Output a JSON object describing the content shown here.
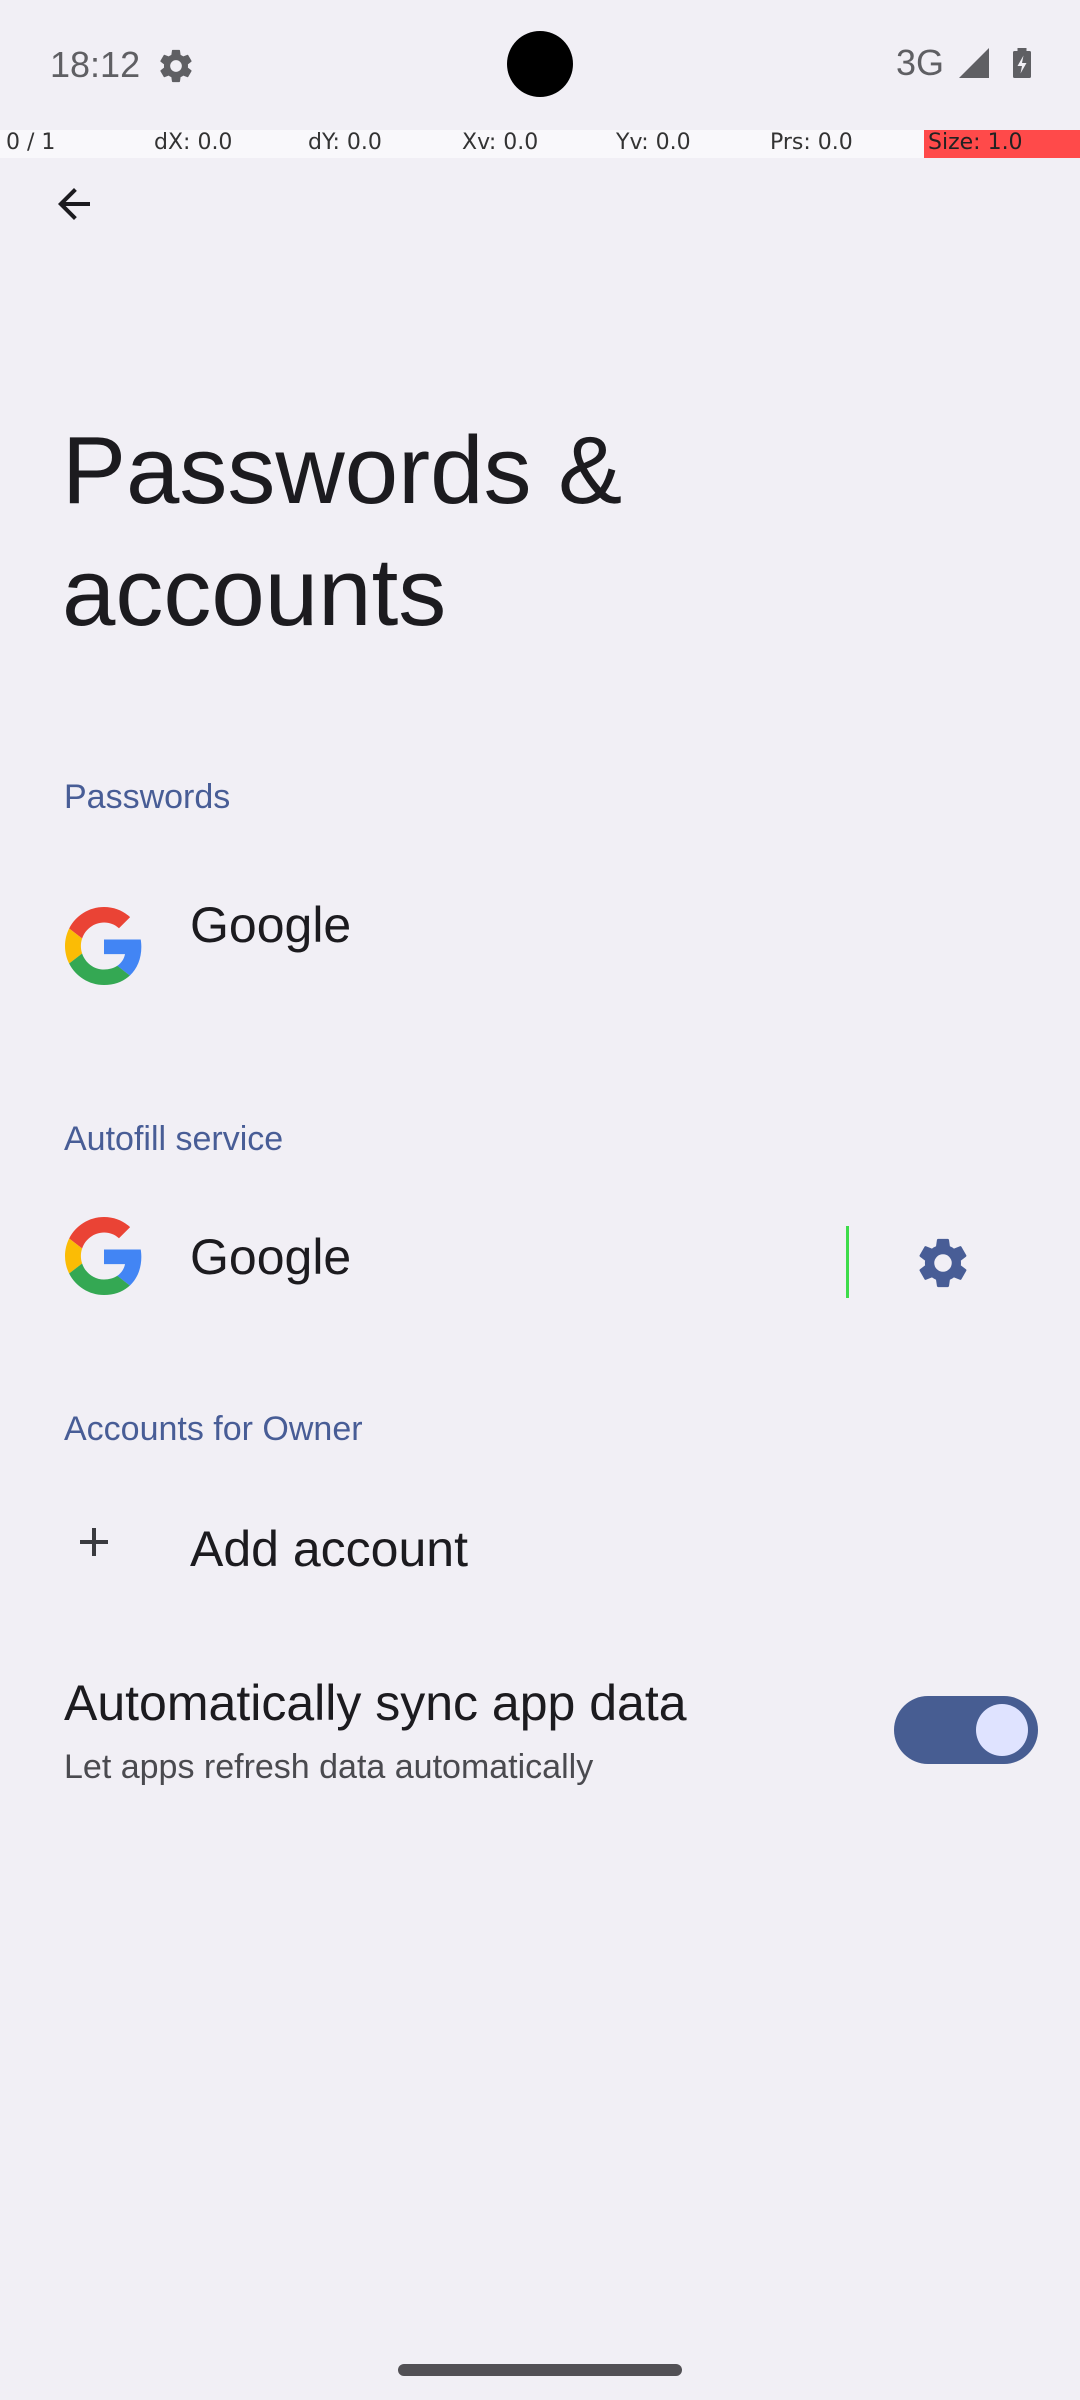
{
  "status_bar": {
    "time": "18:12",
    "network": "3G",
    "icons": [
      "gear-icon",
      "signal-icon",
      "battery-icon"
    ]
  },
  "pointer_overlay": {
    "pointer": "0 / 1",
    "dx": "dX: 0.0",
    "dy": "dY: 0.0",
    "xv": "Xv: 0.0",
    "yv": "Yv: 0.0",
    "prs": "Prs: 0.0",
    "size": "Size: 1.0"
  },
  "toolbar": {
    "back_icon": "arrow-back-icon"
  },
  "page": {
    "title": "Passwords & accounts"
  },
  "sections": {
    "passwords": {
      "header": "Passwords",
      "items": [
        {
          "title": "Google",
          "icon": "google-icon"
        }
      ]
    },
    "autofill": {
      "header": "Autofill service",
      "items": [
        {
          "title": "Google",
          "icon": "google-icon",
          "settings_icon": "gear-icon"
        }
      ]
    },
    "accounts": {
      "header": "Accounts for Owner",
      "items": [
        {
          "title": "Add account",
          "icon": "plus-icon"
        }
      ]
    },
    "sync": {
      "title": "Automatically sync app data",
      "summary": "Let apps refresh data automatically",
      "checked": true
    }
  },
  "colors": {
    "background": "#f1eff5",
    "accent": "#485d96",
    "toggle_track": "#475d92",
    "toggle_thumb": "#dfe3ff"
  }
}
